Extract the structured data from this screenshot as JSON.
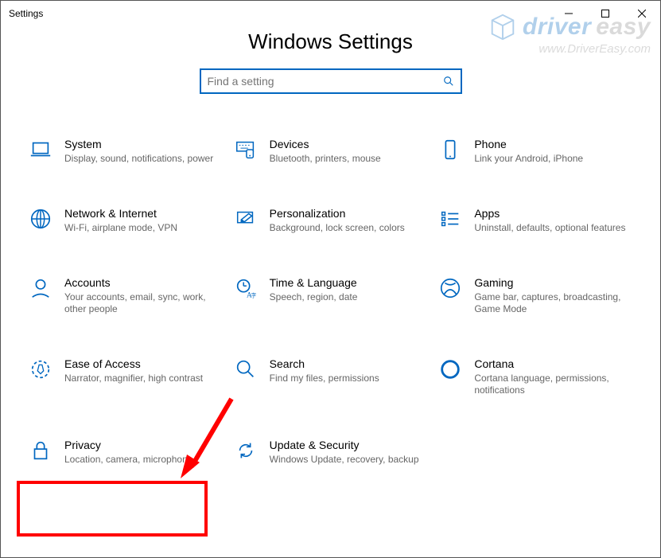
{
  "window": {
    "title": "Settings"
  },
  "header": {
    "title": "Windows Settings"
  },
  "search": {
    "placeholder": "Find a setting"
  },
  "tiles": [
    {
      "id": "system",
      "title": "System",
      "desc": "Display, sound, notifications, power"
    },
    {
      "id": "devices",
      "title": "Devices",
      "desc": "Bluetooth, printers, mouse"
    },
    {
      "id": "phone",
      "title": "Phone",
      "desc": "Link your Android, iPhone"
    },
    {
      "id": "network",
      "title": "Network & Internet",
      "desc": "Wi-Fi, airplane mode, VPN"
    },
    {
      "id": "personalization",
      "title": "Personalization",
      "desc": "Background, lock screen, colors"
    },
    {
      "id": "apps",
      "title": "Apps",
      "desc": "Uninstall, defaults, optional features"
    },
    {
      "id": "accounts",
      "title": "Accounts",
      "desc": "Your accounts, email, sync, work, other people"
    },
    {
      "id": "time",
      "title": "Time & Language",
      "desc": "Speech, region, date"
    },
    {
      "id": "gaming",
      "title": "Gaming",
      "desc": "Game bar, captures, broadcasting, Game Mode"
    },
    {
      "id": "ease",
      "title": "Ease of Access",
      "desc": "Narrator, magnifier, high contrast"
    },
    {
      "id": "search-cat",
      "title": "Search",
      "desc": "Find my files, permissions"
    },
    {
      "id": "cortana",
      "title": "Cortana",
      "desc": "Cortana language, permissions, notifications"
    },
    {
      "id": "privacy",
      "title": "Privacy",
      "desc": "Location, camera, microphone"
    },
    {
      "id": "update",
      "title": "Update & Security",
      "desc": "Windows Update, recovery, backup"
    }
  ],
  "watermark": {
    "brand1": "driver",
    "brand2": "easy",
    "site": "www.DriverEasy.com"
  },
  "annotation": {
    "highlight_target": "privacy",
    "arrow_color": "#ff0000"
  }
}
